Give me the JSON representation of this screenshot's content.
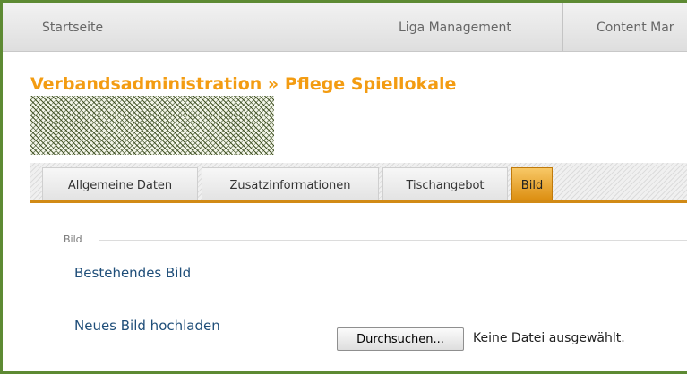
{
  "topnav": {
    "items": [
      "Startseite",
      "Liga Management",
      "Content Mar"
    ]
  },
  "page": {
    "title": "Verbandsadministration » Pflege Spiellokale"
  },
  "tabs": [
    {
      "label": "Allgemeine Daten",
      "active": false
    },
    {
      "label": "Zusatzinformationen",
      "active": false
    },
    {
      "label": "Tischangebot",
      "active": false
    },
    {
      "label": "Bild",
      "active": true
    }
  ],
  "form": {
    "legend": "Bild",
    "existing_label": "Bestehendes Bild",
    "upload_label": "Neues Bild hochladen",
    "browse_button": "Durchsuchen...",
    "file_status": "Keine Datei ausgewählt."
  },
  "colors": {
    "frame": "#5d8a33",
    "title": "#f39c12",
    "active_tab": "#dc8e10",
    "label": "#1f4e79"
  }
}
